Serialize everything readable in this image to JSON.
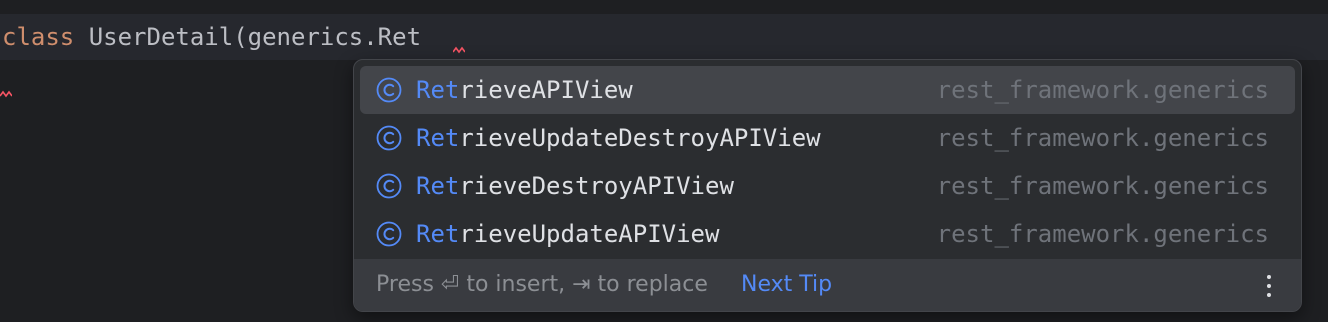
{
  "editor": {
    "keyword": "class",
    "code_rest": " UserDetail(generics.Ret"
  },
  "completion": {
    "items": [
      {
        "match": "Ret",
        "rest": "rieveAPIView",
        "package": "rest_framework.generics",
        "icon": "class-icon",
        "selected": true
      },
      {
        "match": "Ret",
        "rest": "rieveUpdateDestroyAPIView",
        "package": "rest_framework.generics",
        "icon": "class-icon",
        "selected": false
      },
      {
        "match": "Ret",
        "rest": "rieveDestroyAPIView",
        "package": "rest_framework.generics",
        "icon": "class-icon",
        "selected": false
      },
      {
        "match": "Ret",
        "rest": "rieveUpdateAPIView",
        "package": "rest_framework.generics",
        "icon": "class-icon",
        "selected": false
      }
    ],
    "footer": {
      "tip": "Press ⏎ to insert, ⇥ to replace",
      "next_tip": "Next Tip",
      "menu_icon": "more-vertical-icon"
    }
  },
  "colors": {
    "background": "#1e1f22",
    "current_line": "#26282e",
    "keyword": "#cf8e6d",
    "text": "#bcbec4",
    "accent": "#548af7",
    "package": "#6f737a",
    "popup": "#2b2d30",
    "selected": "#43454a",
    "error": "#f75464"
  }
}
